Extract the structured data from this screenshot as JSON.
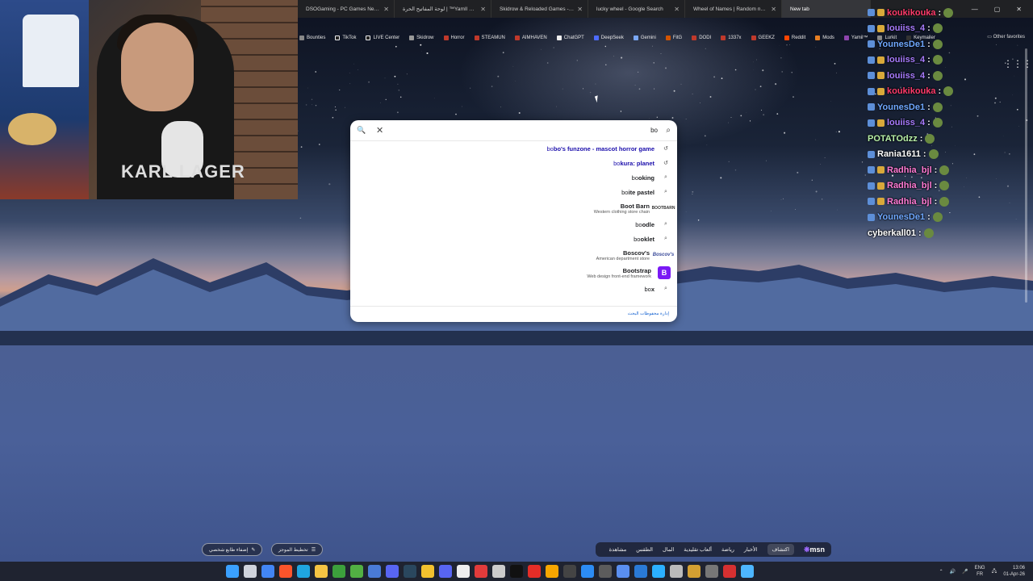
{
  "browser": {
    "tabs": [
      {
        "title": "DSOGaming - PC Games News, Sc",
        "active": false
      },
      {
        "title": "لوحة المفاتيح الحرة | ™YamIl سجل",
        "active": false
      },
      {
        "title": "Skidrow & Reloaded Games - Do",
        "active": false
      },
      {
        "title": "lucky wheel - Google Search",
        "active": false
      },
      {
        "title": "Wheel of Names | Random name",
        "active": false
      },
      {
        "title": "New tab",
        "active": true
      }
    ],
    "bookmarks": [
      "Bounties",
      "TikTok",
      "LIVE Center",
      "Skidrow",
      "Horror",
      "STEAMUN",
      "AIMHAVEN",
      "ChatGPT",
      "DeepSeek",
      "Gemini",
      "FitG",
      "DODI",
      "1337x",
      "GEEKZ",
      "Reddit",
      "Mods",
      "Yamil™",
      "Lurkit",
      "Keymailer"
    ],
    "other_favorites": "Other favorites"
  },
  "search": {
    "query": "bo",
    "suggestions": [
      {
        "prefix": "bo",
        "rest": "bo's funzone - mascot horror game",
        "sub": "",
        "type": "history"
      },
      {
        "prefix": "bo",
        "rest": "kura: planet",
        "sub": "",
        "type": "history"
      },
      {
        "prefix": "bo",
        "rest": "oking",
        "sub": "",
        "type": "search"
      },
      {
        "prefix": "bo",
        "rest": "ite pastel",
        "sub": "",
        "type": "search"
      },
      {
        "prefix": "",
        "rest": "Boot Barn",
        "sub": "Western clothing store chain",
        "type": "entity",
        "logo": "BOOTBARN"
      },
      {
        "prefix": "bo",
        "rest": "odle",
        "sub": "",
        "type": "search"
      },
      {
        "prefix": "bo",
        "rest": "oklet",
        "sub": "",
        "type": "search"
      },
      {
        "prefix": "",
        "rest": "Boscov's",
        "sub": "American department store",
        "type": "entity",
        "logo": "Boscov's"
      },
      {
        "prefix": "",
        "rest": "Bootstrap",
        "sub": "Web design front-end framework",
        "type": "entity",
        "logo": "B"
      },
      {
        "prefix": "bo",
        "rest": "x",
        "sub": "",
        "type": "search"
      }
    ],
    "footer": "إدارة محفوظات البحث"
  },
  "chat": [
    {
      "user": "koukikouka",
      "color": "#ff3b6b",
      "badges": [
        "blue",
        "gold"
      ]
    },
    {
      "user": "louiiss_4",
      "color": "#a87cff",
      "badges": [
        "blue",
        "gold"
      ]
    },
    {
      "user": "YounesDe1",
      "color": "#6fa8ff",
      "badges": [
        "blue"
      ]
    },
    {
      "user": "louiiss_4",
      "color": "#a87cff",
      "badges": [
        "blue",
        "gold"
      ]
    },
    {
      "user": "louiiss_4",
      "color": "#a87cff",
      "badges": [
        "blue",
        "gold"
      ]
    },
    {
      "user": "koukikouka",
      "color": "#ff3b6b",
      "badges": [
        "blue",
        "gold"
      ]
    },
    {
      "user": "YounesDe1",
      "color": "#6fa8ff",
      "badges": [
        "blue"
      ]
    },
    {
      "user": "louiiss_4",
      "color": "#a87cff",
      "badges": [
        "blue",
        "gold"
      ]
    },
    {
      "user": "POTATOdzz",
      "color": "#b8f0a8",
      "badges": []
    },
    {
      "user": "Rania1611",
      "color": "#ffffff",
      "badges": [
        "blue"
      ]
    },
    {
      "user": "Radhia_bjl",
      "color": "#ff7bd5",
      "badges": [
        "blue",
        "gold"
      ]
    },
    {
      "user": "Radhia_bjl",
      "color": "#ff7bd5",
      "badges": [
        "blue",
        "gold"
      ]
    },
    {
      "user": "Radhia_bjl",
      "color": "#ff7bd5",
      "badges": [
        "blue",
        "gold"
      ]
    },
    {
      "user": "YounesDe1",
      "color": "#6fa8ff",
      "badges": [
        "blue"
      ]
    },
    {
      "user": "cyberkall01",
      "color": "#ffffff",
      "badges": []
    }
  ],
  "chat_separator": ":",
  "webcam": {
    "shirt_text": "KARL LAGER"
  },
  "msn": {
    "tabs": [
      "مشاهدة",
      "الطقس",
      "المال",
      "ألعاب تقليدية",
      "رياضة",
      "الأخبار",
      "اكتشاف"
    ],
    "logo": "msn",
    "personalize": "إضفاء طابع شخصي",
    "layout": "تخطيط الموجز"
  },
  "taskbar": {
    "lang_top": "ENG",
    "lang_bottom": "FR",
    "time": "13:06",
    "date": "01-Apr-26"
  }
}
